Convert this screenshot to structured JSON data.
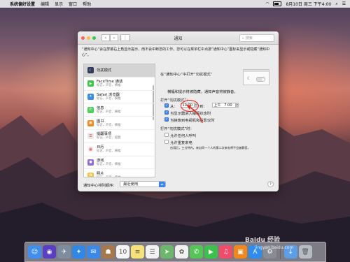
{
  "menubar": {
    "app_name": "系统偏好设置",
    "items": [
      "编辑",
      "显示",
      "窗口",
      "帮助"
    ],
    "clock": "8月10日 周三 下午4:00"
  },
  "window": {
    "title": "通知",
    "search_placeholder": "搜索",
    "description": "“通知中心”会在屏幕右上角显示提示，而不会中断您的工作。您可以在菜单栏中点按“通知中心”图标来显示或隐藏“通知中心”。"
  },
  "app_list": [
    {
      "name": "勿扰模式",
      "sub": "",
      "icon": "moon-icon",
      "color": "#2f3b5c",
      "selected": true
    },
    {
      "name": "FaceTime 通话",
      "sub": "标记、声音、横幅",
      "icon": "facetime-icon",
      "color": "#3cc64b"
    },
    {
      "name": "Safari 浏览器",
      "sub": "标记、声音、横幅",
      "icon": "safari-icon",
      "color": "#3a8ee6"
    },
    {
      "name": "信息",
      "sub": "标记、声音、横幅",
      "icon": "messages-icon",
      "color": "#4bd15b"
    },
    {
      "name": "图书",
      "sub": "标记、声音、横幅",
      "icon": "books-icon",
      "color": "#f28a1e"
    },
    {
      "name": "提醒事项",
      "sub": "标记、声音、提醒",
      "icon": "reminders-icon",
      "color": "#e9e9e9"
    },
    {
      "name": "日历",
      "sub": "标记、声音、横幅",
      "icon": "calendar-icon",
      "color": "#f4f4f4"
    },
    {
      "name": "游戏",
      "sub": "标记、声音、横幅",
      "icon": "game-center-icon",
      "color": "#8e6ed8"
    },
    {
      "name": "照片",
      "sub": "标记、声音、横幅",
      "icon": "photos-icon",
      "color": "#f5c542"
    }
  ],
  "dnd": {
    "heading": "在“通知中心”中打开“勿扰模式”",
    "hint": "横幅和提示将被隐藏，通知声音将被静音。",
    "turn_on_label": "打开“勿扰模式”：",
    "from_label": "从：",
    "from_time": "10:00",
    "to_label": "到：",
    "to_ampm": "上午",
    "to_time": "7:00",
    "option_display_sleep": "当显示器进入睡眠状态时",
    "option_mirroring": "当镜像到电视机和投影仪时",
    "when_on_label": "打开“勿扰模式”时：",
    "allow_calls": "允许任何人呼叫",
    "allow_repeated": "允许重复来电",
    "repeated_hint": "启用后，三分钟内，来自同一个人的第二次来电将不会被静音。"
  },
  "bottom": {
    "sort_label": "通知中心排列顺序：",
    "sort_value": "最近使用",
    "help": "?"
  },
  "dock": [
    {
      "name": "finder-icon",
      "glyph": "☺",
      "color": "#3e8ff0"
    },
    {
      "name": "siri-icon",
      "glyph": "◉",
      "color": "#5a3fc4"
    },
    {
      "name": "launchpad-icon",
      "glyph": "✈",
      "color": "#7d8da0"
    },
    {
      "name": "safari-icon",
      "glyph": "✦",
      "color": "#2f87e6"
    },
    {
      "name": "mail-icon",
      "glyph": "✉",
      "color": "#3c8ae8"
    },
    {
      "name": "contacts-icon",
      "glyph": "☗",
      "color": "#a9784a"
    },
    {
      "name": "calendar-icon",
      "glyph": "10",
      "color": "#f5f5f5"
    },
    {
      "name": "notes-icon",
      "glyph": "≡",
      "color": "#f7e27a"
    },
    {
      "name": "reminders-icon",
      "glyph": "☰",
      "color": "#f2f2f2"
    },
    {
      "name": "maps-icon",
      "glyph": "➤",
      "color": "#6bb86a"
    },
    {
      "name": "photos-icon",
      "glyph": "✿",
      "color": "#f1f1f1"
    },
    {
      "name": "messages-icon",
      "glyph": "✆",
      "color": "#55c656"
    },
    {
      "name": "facetime-icon",
      "glyph": "▶",
      "color": "#3cc24a"
    },
    {
      "name": "music-icon",
      "glyph": "♫",
      "color": "#f24b6a"
    },
    {
      "name": "books-icon",
      "glyph": "▣",
      "color": "#f0881c"
    },
    {
      "name": "app-store-icon",
      "glyph": "A",
      "color": "#2c8cf0"
    },
    {
      "name": "system-preferences-icon",
      "glyph": "⚙",
      "color": "#888c94"
    },
    {
      "name": "downloads-icon",
      "glyph": "↓",
      "color": "#5b9fe8"
    },
    {
      "name": "trash-icon",
      "glyph": "🗑",
      "color": "#b6bcc4"
    }
  ]
}
